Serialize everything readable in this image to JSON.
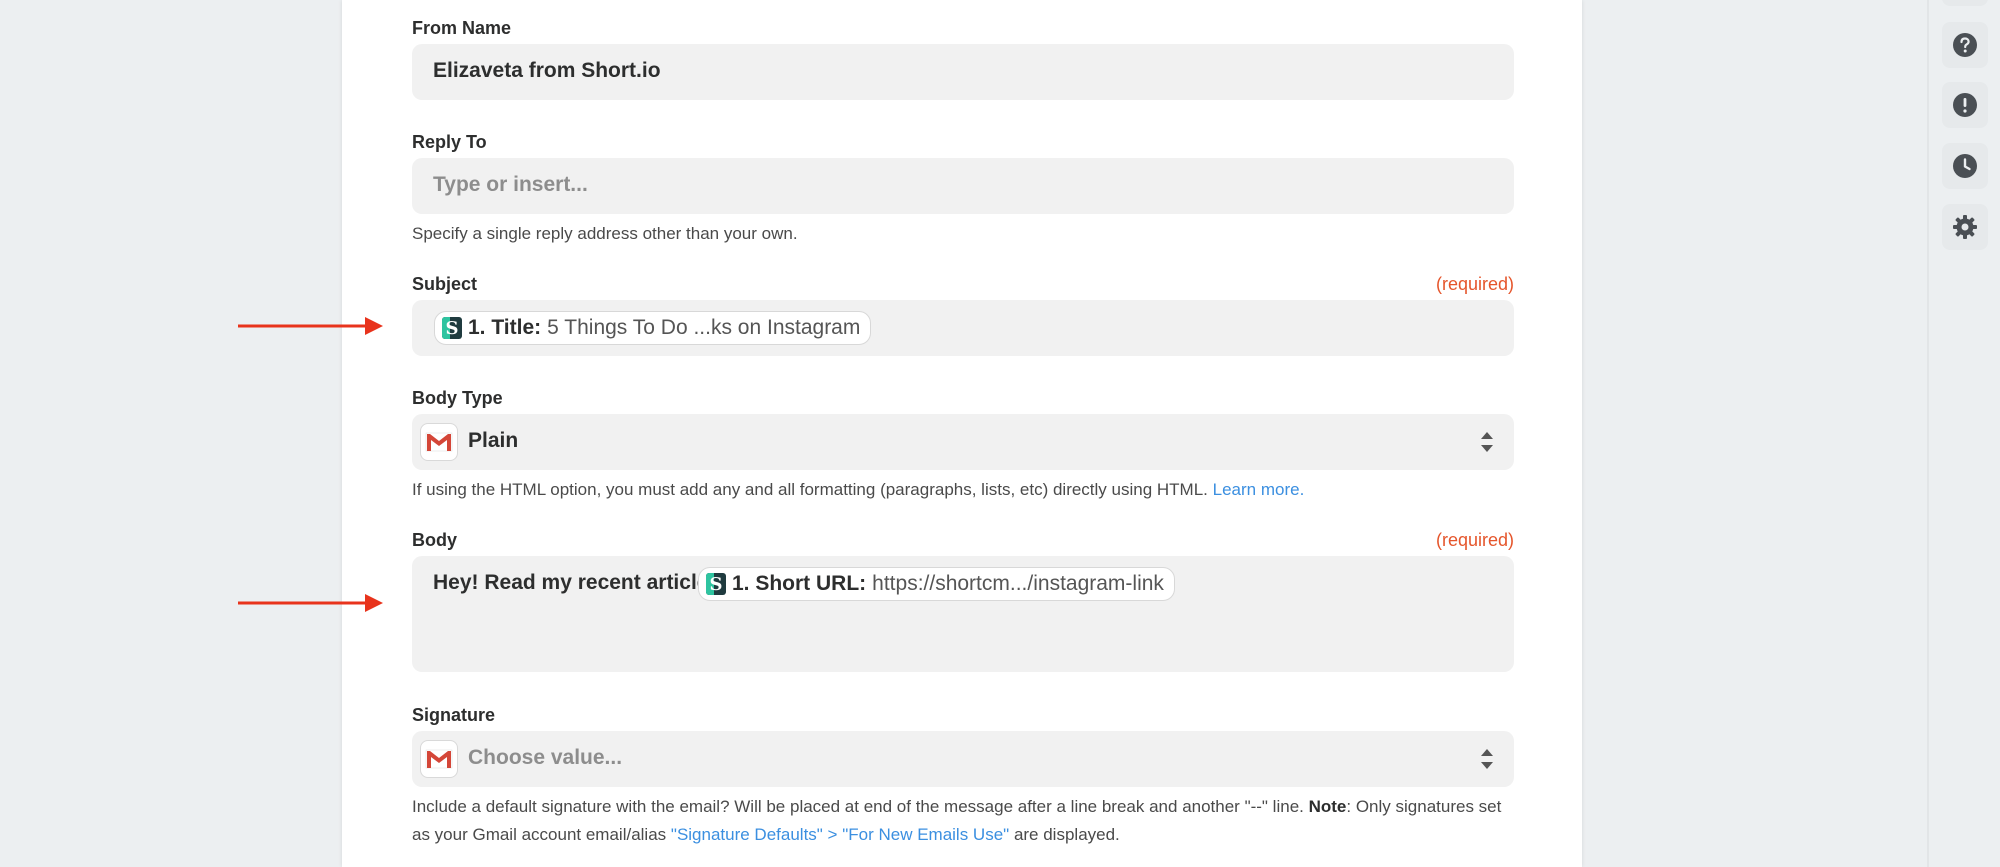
{
  "form": {
    "from_name": {
      "label": "From Name",
      "value": "Elizaveta from Short.io"
    },
    "reply_to": {
      "label": "Reply To",
      "placeholder": "Type or insert...",
      "help": "Specify a single reply address other than your own."
    },
    "subject": {
      "label": "Subject",
      "required": "(required)",
      "token": {
        "key": "1. Title:",
        "value": "5 Things To Do ...ks on Instagram"
      }
    },
    "body_type": {
      "label": "Body Type",
      "value": "Plain",
      "help_prefix": "If using the HTML option, you must add any and all formatting (paragraphs, lists, etc) directly using HTML.",
      "help_link": "Learn more."
    },
    "body": {
      "label": "Body",
      "required": "(required)",
      "text": "Hey! Read my recent article",
      "token": {
        "key": "1. Short URL:",
        "value": "https://shortcm.../instagram-link"
      }
    },
    "signature": {
      "label": "Signature",
      "placeholder": "Choose value...",
      "help_part1": "Include a default signature with the email? Will be placed at end of the message after a line break and another \"--\" line.",
      "help_note": "Note",
      "help_part2": ": Only signatures set as your Gmail account email/alias",
      "help_link": "\"Signature Defaults\" > \"For New Emails Use\"",
      "help_part3": "are displayed."
    }
  },
  "right_rail": {
    "buttons": [
      "help-icon",
      "alert-icon",
      "history-icon",
      "settings-icon"
    ]
  },
  "colors": {
    "required": "#e5552b",
    "link": "#3b8fe0",
    "arrow": "#e8331c",
    "field_bg": "#f1f1f1"
  }
}
